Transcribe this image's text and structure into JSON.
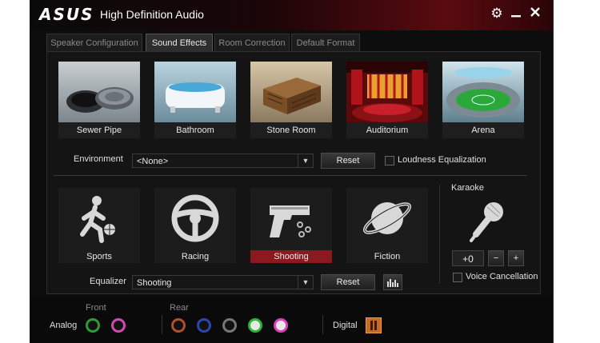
{
  "window": {
    "logo": "ASUS",
    "title": "High Definition Audio",
    "icons": {
      "settings": "gear-icon",
      "minimize": "minimize-icon",
      "close": "close-icon"
    }
  },
  "tabs": [
    {
      "label": "Speaker Configuration",
      "active": false
    },
    {
      "label": "Sound Effects",
      "active": true
    },
    {
      "label": "Room Correction",
      "active": false
    },
    {
      "label": "Default Format",
      "active": false
    }
  ],
  "environments": [
    {
      "label": "Sewer Pipe"
    },
    {
      "label": "Bathroom"
    },
    {
      "label": "Stone Room"
    },
    {
      "label": "Auditorium"
    },
    {
      "label": "Arena"
    }
  ],
  "environment": {
    "label": "Environment",
    "selected": "<None>",
    "reset_label": "Reset",
    "loudness_label": "Loudness Equalization",
    "loudness_checked": false
  },
  "equalizer_presets": [
    {
      "label": "Sports",
      "icon": "sports-icon",
      "selected": false
    },
    {
      "label": "Racing",
      "icon": "steering-wheel-icon",
      "selected": false
    },
    {
      "label": "Shooting",
      "icon": "pistol-icon",
      "selected": true
    },
    {
      "label": "Fiction",
      "icon": "planet-icon",
      "selected": false
    }
  ],
  "equalizer": {
    "label": "Equalizer",
    "selected": "Shooting",
    "reset_label": "Reset",
    "graph_icon": "equalizer-bars-icon"
  },
  "karaoke": {
    "label": "Karaoke",
    "value": "+0",
    "minus": "−",
    "plus": "+",
    "voice_cancel_label": "Voice Cancellation",
    "voice_cancel_checked": false
  },
  "jacks": {
    "front_label": "Front",
    "rear_label": "Rear",
    "analog_label": "Analog",
    "digital_label": "Digital",
    "front_colors": [
      "#2f9a3a",
      "#d04ab0"
    ],
    "rear_colors": [
      "#b0502a",
      "#2a46b0",
      "#777777",
      "#2fb53a",
      "#e040c0"
    ]
  },
  "colors": {
    "accent": "#8a1a1f",
    "background": "#0d0d0d"
  }
}
